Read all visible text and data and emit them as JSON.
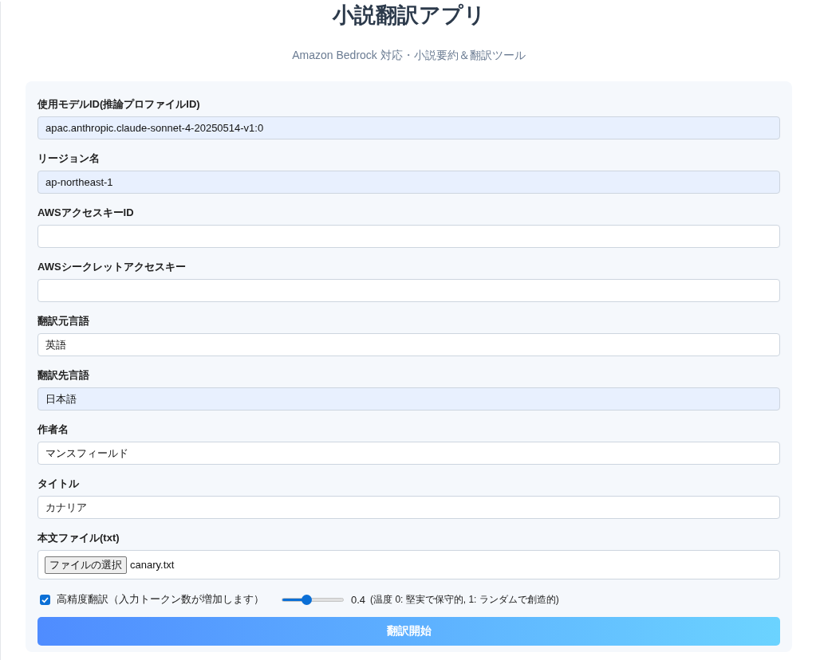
{
  "title": "小説翻訳アプリ",
  "subtitle": "Amazon Bedrock 対応・小説要約＆翻訳ツール",
  "fields": [
    {
      "kind": "text",
      "label": "使用モデルID(推論プロファイルID)",
      "value": "apac.anthropic.claude-sonnet-4-20250514-v1:0",
      "autofilled": true
    },
    {
      "kind": "text",
      "label": "リージョン名",
      "value": "ap-northeast-1",
      "autofilled": true
    },
    {
      "kind": "text",
      "label": "AWSアクセスキーID",
      "autofilled": false
    },
    {
      "kind": "text",
      "label": "AWSシークレットアクセスキー",
      "autofilled": false
    },
    {
      "kind": "text",
      "label": "翻訳元言語",
      "value": "英語",
      "autofilled": false
    },
    {
      "kind": "text",
      "label": "翻訳先言語",
      "value": "日本語",
      "autofilled": true
    },
    {
      "kind": "text",
      "label": "作者名",
      "value": "マンスフィールド",
      "autofilled": false
    },
    {
      "kind": "text",
      "label": "タイトル",
      "value": "カナリア",
      "autofilled": false
    },
    {
      "kind": "file",
      "label": "本文ファイル(txt)",
      "button": "ファイルの選択",
      "value": "canary.txt"
    }
  ],
  "options": {
    "high_precision": {
      "label": "高精度翻訳（入力トークン数が増加します）",
      "checked": true
    },
    "temperature": {
      "level": 0.4,
      "reading": "0.4",
      "hint": "(温度 0: 堅実で保守的, 1: ランダムで創造的)"
    }
  },
  "submit": "翻訳開始"
}
